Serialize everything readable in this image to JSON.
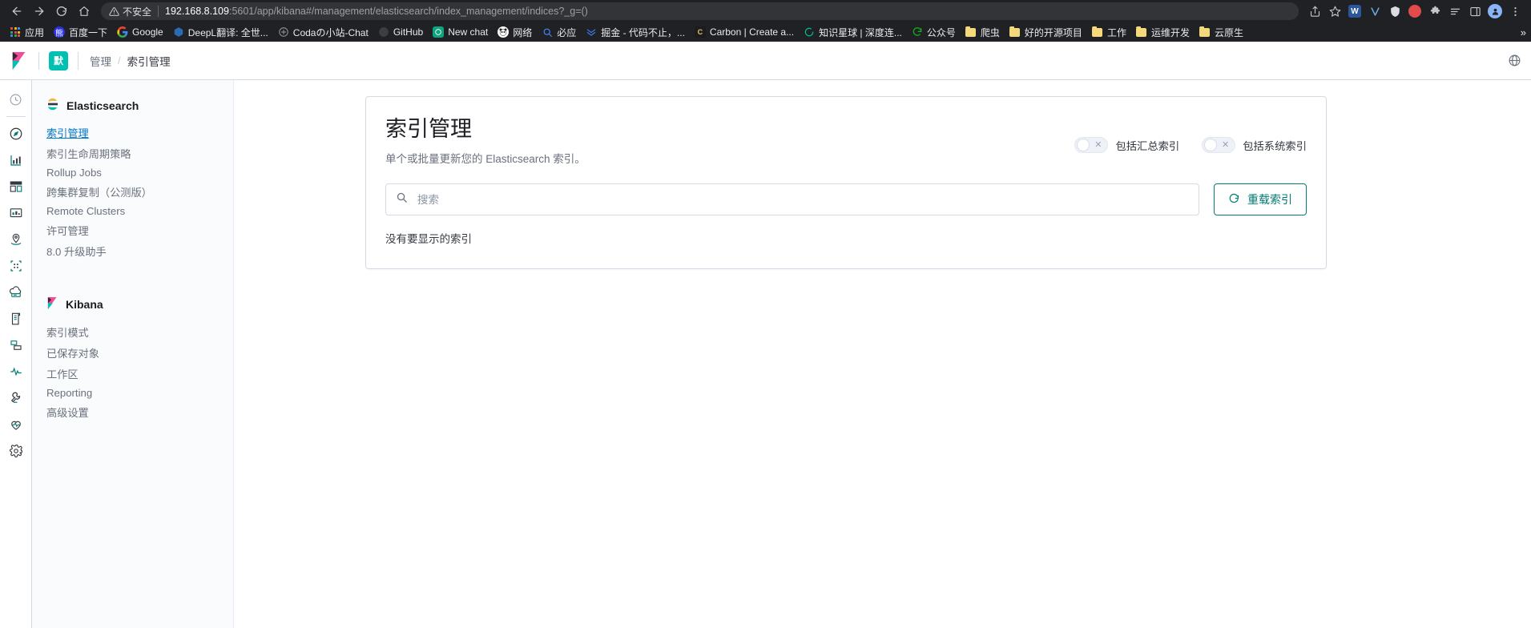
{
  "browser": {
    "nav": {
      "back_label": "Back",
      "forward_label": "Forward",
      "reload_label": "Reload",
      "home_label": "Home"
    },
    "omnibox": {
      "security_label": "不安全",
      "url_host": "192.168.8.109",
      "url_path": ":5601/app/kibana#/management/elasticsearch/index_management/indices?_g=()"
    },
    "right_icons": [
      {
        "name": "share-icon",
        "glyph": "⇪"
      },
      {
        "name": "bookmark-star-icon",
        "glyph": "☆"
      },
      {
        "name": "extension-word-icon",
        "glyph": "W",
        "color": "#2b579a"
      },
      {
        "name": "extension-v-icon",
        "glyph": "V",
        "color": "#4a90d9"
      },
      {
        "name": "extension-shield-icon",
        "glyph": "◆",
        "color": "#e0e0e0"
      },
      {
        "name": "extension-record-icon",
        "glyph": "●",
        "color": "#e34a4a"
      },
      {
        "name": "extension-puzzle-icon",
        "glyph": "🧩"
      },
      {
        "name": "extension-list-icon",
        "glyph": "☰"
      },
      {
        "name": "sidepanel-icon",
        "glyph": "▢"
      },
      {
        "name": "profile-avatar",
        "glyph": "●"
      },
      {
        "name": "chrome-menu-icon",
        "glyph": "⋮"
      }
    ],
    "bookmarks": [
      {
        "label": "应用",
        "icon": "apps-grid-icon"
      },
      {
        "label": "百度一下",
        "icon": "baidu-icon"
      },
      {
        "label": "Google",
        "icon": "google-icon"
      },
      {
        "label": "DeepL翻译: 全世...",
        "icon": "deepl-icon"
      },
      {
        "label": "Codaの小站-Chat",
        "icon": "openai-icon"
      },
      {
        "label": "GitHub",
        "icon": "github-icon"
      },
      {
        "label": "New chat",
        "icon": "openai-icon"
      },
      {
        "label": "网络",
        "icon": "panda-icon"
      },
      {
        "label": "必应",
        "icon": "bing-search-icon"
      },
      {
        "label": "掘金 - 代码不止，...",
        "icon": "juejin-icon"
      },
      {
        "label": "Carbon | Create a...",
        "icon": "carbon-icon"
      },
      {
        "label": "知识星球 | 深度连...",
        "icon": "zsxq-icon"
      },
      {
        "label": "公众号",
        "icon": "wechat-icon"
      },
      {
        "label": "爬虫",
        "icon": "folder-icon"
      },
      {
        "label": "好的开源项目",
        "icon": "folder-icon"
      },
      {
        "label": "工作",
        "icon": "folder-icon"
      },
      {
        "label": "运维开发",
        "icon": "folder-icon"
      },
      {
        "label": "云原生",
        "icon": "folder-icon"
      }
    ],
    "bookmarks_overflow": "»"
  },
  "kibana": {
    "header": {
      "space_badge": "默",
      "breadcrumb_1": "管理",
      "breadcrumb_sep": "/",
      "breadcrumb_2": "索引管理"
    },
    "icon_rail": [
      {
        "name": "recently-viewed-icon"
      },
      {
        "name": "discover-icon"
      },
      {
        "name": "visualize-icon"
      },
      {
        "name": "dashboard-icon"
      },
      {
        "name": "canvas-icon"
      },
      {
        "name": "maps-icon"
      },
      {
        "name": "machine-learning-icon"
      },
      {
        "name": "infrastructure-icon"
      },
      {
        "name": "logs-icon"
      },
      {
        "name": "apm-icon"
      },
      {
        "name": "uptime-icon"
      },
      {
        "name": "dev-tools-icon"
      },
      {
        "name": "monitoring-icon"
      },
      {
        "name": "management-gear-icon"
      }
    ],
    "sidebar": {
      "groups": [
        {
          "title": "Elasticsearch",
          "icon": "elasticsearch-logo-icon",
          "items": [
            {
              "label": "索引管理",
              "active": true
            },
            {
              "label": "索引生命周期策略",
              "active": false
            },
            {
              "label": "Rollup Jobs",
              "active": false
            },
            {
              "label": "跨集群复制（公测版）",
              "active": false
            },
            {
              "label": "Remote Clusters",
              "active": false
            },
            {
              "label": "许可管理",
              "active": false
            },
            {
              "label": "8.0 升级助手",
              "active": false
            }
          ]
        },
        {
          "title": "Kibana",
          "icon": "kibana-logo-icon",
          "items": [
            {
              "label": "索引模式",
              "active": false
            },
            {
              "label": "已保存对象",
              "active": false
            },
            {
              "label": "工作区",
              "active": false
            },
            {
              "label": "Reporting",
              "active": false
            },
            {
              "label": "高级设置",
              "active": false
            }
          ]
        }
      ]
    },
    "main": {
      "title": "索引管理",
      "subtitle": "单个或批量更新您的 Elasticsearch 索引。",
      "toggles": [
        {
          "label": "包括汇总索引",
          "checked": false,
          "mark": "✕"
        },
        {
          "label": "包括系统索引",
          "checked": false,
          "mark": "✕"
        }
      ],
      "search_placeholder": "搜索",
      "search_value": "",
      "reload_label": "重载索引",
      "empty_message": "没有要显示的索引"
    },
    "colors": {
      "accent_teal": "#017d73",
      "link_blue": "#0077cc",
      "space_badge_bg": "#00BFB3"
    }
  }
}
